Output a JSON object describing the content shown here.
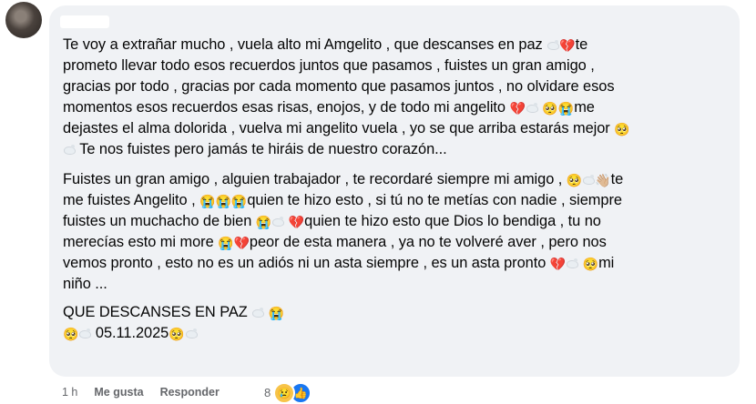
{
  "comment": {
    "paragraphs": [
      [
        {
          "t": "Te voy a extrañar mucho , vuela alto mi Amgelito , que descanses en paz "
        },
        {
          "e": "dove"
        },
        {
          "e": "💔"
        },
        {
          "t": "te"
        },
        {
          "br": 1
        },
        {
          "t": "prometo llevar todo esos recuerdos juntos que pasamos , fuistes un gran amigo ,"
        },
        {
          "br": 1
        },
        {
          "t": "gracias por todo , gracias por cada momento que pasamos juntos , no olvidare esos"
        },
        {
          "br": 1
        },
        {
          "t": "momentos esos recuerdos esas risas, enojos, y de todo mi angelito "
        },
        {
          "e": "💔"
        },
        {
          "e": "dove"
        },
        {
          "t": " "
        },
        {
          "e": "🥺"
        },
        {
          "e": "😭"
        },
        {
          "t": "me"
        },
        {
          "br": 1
        },
        {
          "t": "dejastes el alma dolorida , vuelva mi angelito vuela , yo se que arriba estarás mejor "
        },
        {
          "e": "🥺"
        },
        {
          "br": 1
        },
        {
          "e": "dove"
        },
        {
          "t": " Te nos fuistes pero jamás te hiráis de nuestro corazón..."
        }
      ],
      [
        {
          "t": "Fuistes un gran amigo , alguien trabajador , te recordaré siempre mi amigo , "
        },
        {
          "e": "🥺"
        },
        {
          "e": "dove"
        },
        {
          "e": "👋🏼"
        },
        {
          "t": "te"
        },
        {
          "br": 1
        },
        {
          "t": "me fuistes Angelito , "
        },
        {
          "e": "😭"
        },
        {
          "e": "😭"
        },
        {
          "e": "😭"
        },
        {
          "t": "quien te hizo esto , si tú no te metías con nadie , siempre"
        },
        {
          "br": 1
        },
        {
          "t": "fuistes un muchacho de bien "
        },
        {
          "e": "😭"
        },
        {
          "e": "dove"
        },
        {
          "t": " "
        },
        {
          "e": "💔"
        },
        {
          "t": "quien te hizo esto que Dios lo bendiga , tu no"
        },
        {
          "br": 1
        },
        {
          "t": "merecías esto mi more "
        },
        {
          "e": "😭"
        },
        {
          "e": "💔"
        },
        {
          "t": "peor de esta manera , ya no te volveré aver , pero nos"
        },
        {
          "br": 1
        },
        {
          "t": "vemos pronto , esto no es un adiós ni un asta siempre , es un asta pronto "
        },
        {
          "e": "💔"
        },
        {
          "e": "dove"
        },
        {
          "t": " "
        },
        {
          "e": "🥺"
        },
        {
          "t": "mi"
        },
        {
          "br": 1
        },
        {
          "t": "niño ..."
        }
      ],
      [
        {
          "t": "QUE DESCANSES EN PAZ "
        },
        {
          "e": "dove"
        },
        {
          "t": " "
        },
        {
          "e": "😭"
        },
        {
          "br": 1
        },
        {
          "e": "🥺"
        },
        {
          "e": "dove"
        },
        {
          "t": " 05.11.2025"
        },
        {
          "e": "🥺"
        },
        {
          "e": "dove"
        }
      ]
    ]
  },
  "actions": {
    "time": "1 h",
    "like": "Me gusta",
    "reply": "Responder"
  },
  "reactions": {
    "count": "8",
    "icons": [
      "sad-icon",
      "like-icon"
    ]
  }
}
